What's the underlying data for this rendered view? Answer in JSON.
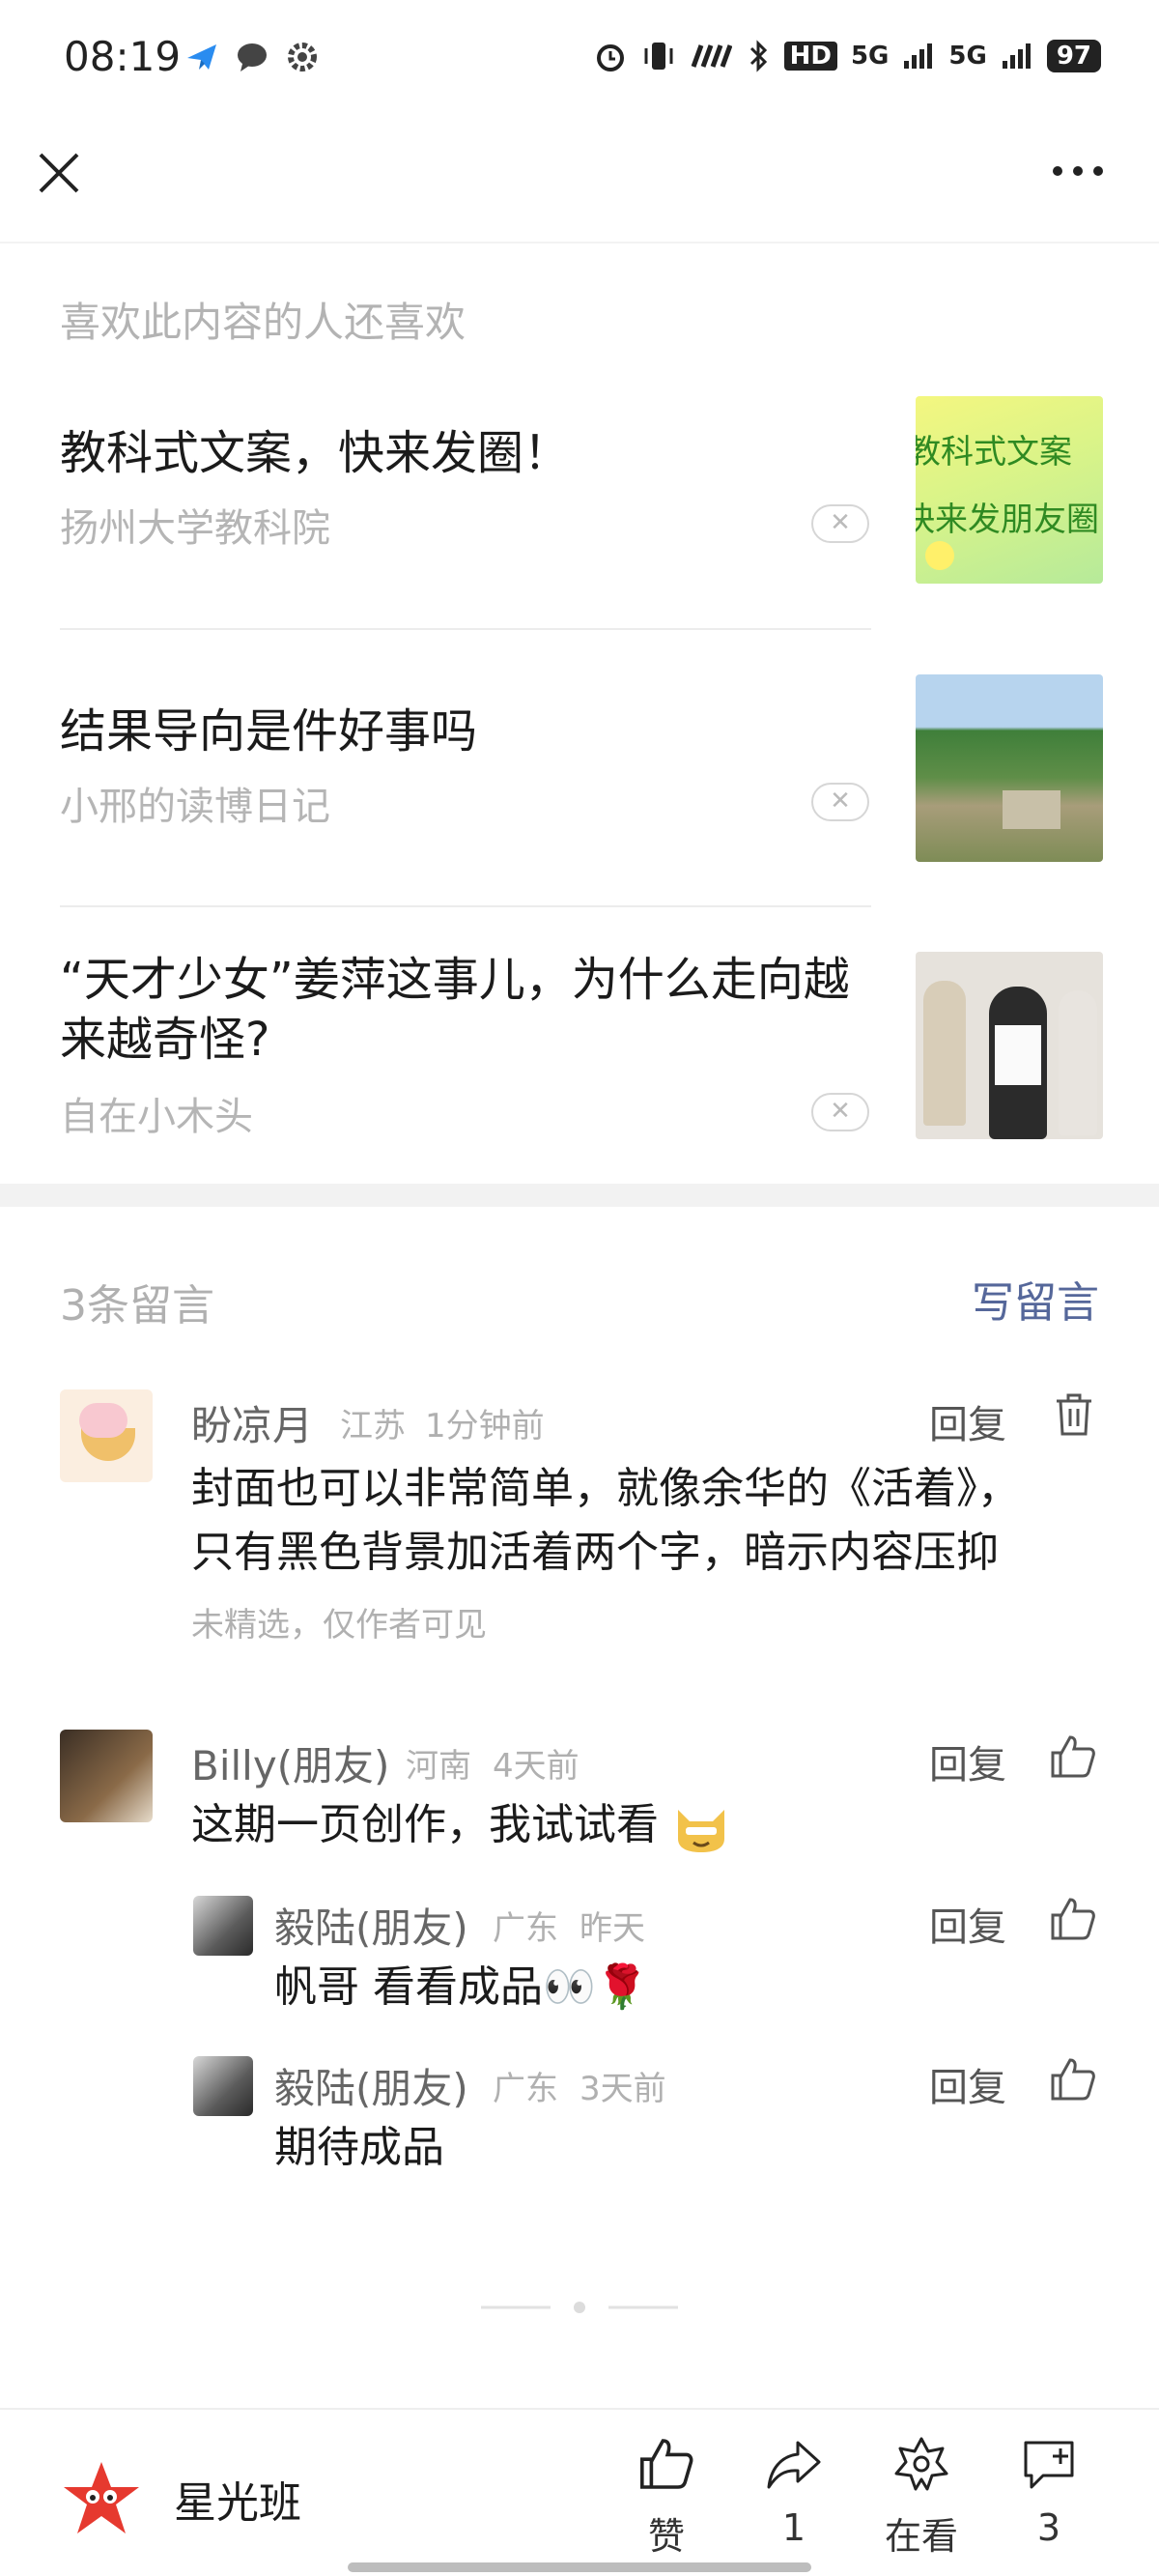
{
  "status": {
    "time": "08:19",
    "battery": "97",
    "signal_text": [
      "5G",
      "5G"
    ],
    "hd": "HD"
  },
  "recommend": {
    "title": "喜欢此内容的人还喜欢",
    "items": [
      {
        "title": "教科式文案，快来发圈！",
        "source": "扬州大学教科院",
        "thumb_text": [
          "教科式文案",
          "快来发朋友圈"
        ]
      },
      {
        "title": "结果导向是件好事吗",
        "source": "小邢的读博日记"
      },
      {
        "title": "“天才少女”姜萍这事儿，为什么走向越来越奇怪?",
        "source": "自在小木头"
      }
    ]
  },
  "comments": {
    "count_label": "3条留言",
    "write_label": "写留言",
    "list": [
      {
        "name": "盼凉月",
        "region": "江苏",
        "time": "1分钟前",
        "reply": "回复",
        "text_lines": [
          "封面也可以非常简单，就像余华的《活着》，",
          "只有黑色背景加活着两个字，暗示内容压抑"
        ],
        "note": "未精选，仅作者可见"
      },
      {
        "name": "Billy(朋友)",
        "region": "河南",
        "time": "4天前",
        "reply": "回复",
        "text": "这期一页创作，我试试看"
      },
      {
        "name": "毅陆(朋友)",
        "region": "广东",
        "time": "昨天",
        "reply": "回复",
        "text": "帆哥 看看成品👀🌹"
      },
      {
        "name": "毅陆(朋友)",
        "region": "广东",
        "time": "3天前",
        "reply": "回复",
        "text": "期待成品"
      }
    ]
  },
  "bottom": {
    "account": "星光班",
    "like_label": "赞",
    "share_count": "1",
    "watching_label": "在看",
    "comment_count": "3"
  }
}
